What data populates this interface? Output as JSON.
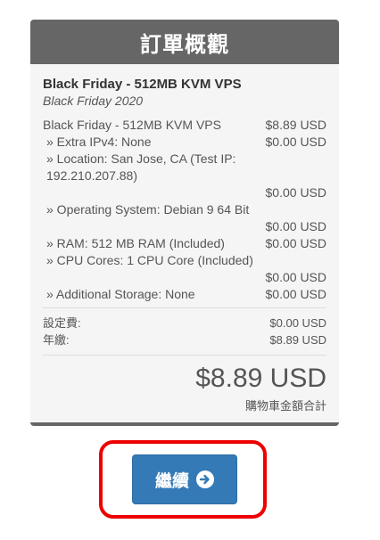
{
  "summary": {
    "title": "訂單概觀",
    "product_name": "Black Friday - 512MB KVM VPS",
    "product_group": "Black Friday 2020",
    "lines": [
      {
        "label": "Black Friday - 512MB KVM VPS",
        "amount": "$8.89 USD"
      },
      {
        "label": "» Extra IPv4: None",
        "amount": "$0.00 USD"
      },
      {
        "label": "» Location: San Jose, CA (Test IP: 192.210.207.88)",
        "amount": "$0.00 USD"
      },
      {
        "label": "» Operating System: Debian 9 64 Bit",
        "amount": "$0.00 USD"
      },
      {
        "label": "» RAM: 512 MB RAM (Included)",
        "amount": "$0.00 USD"
      },
      {
        "label": "» CPU Cores: 1 CPU Core (Included)",
        "amount": "$0.00 USD"
      },
      {
        "label": "» Additional Storage: None",
        "amount": "$0.00 USD"
      }
    ],
    "setup_fee_label": "設定費:",
    "setup_fee_amount": "$0.00 USD",
    "annual_label": "年繳:",
    "annual_amount": "$8.89 USD",
    "total_amount": "$8.89 USD",
    "total_label": "購物車金額合計"
  },
  "continue_button": {
    "label": "繼續",
    "icon": "arrow-circle-right-icon"
  },
  "colors": {
    "header_bg": "#666666",
    "button_bg": "#337ab7",
    "highlight": "#ee0000"
  }
}
